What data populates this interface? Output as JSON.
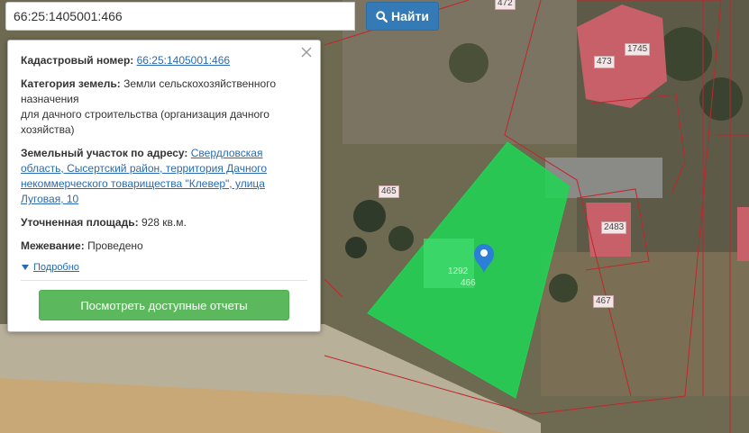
{
  "search": {
    "value": "66:25:1405001:466",
    "button_label": "Найти"
  },
  "info": {
    "cadastral_label": "Кадастровый номер:",
    "cadastral_value": "66:25:1405001:466",
    "category_label": "Категория земель:",
    "category_value": "Земли сельскохозяйственного назначения",
    "category_value_2": "для дачного строительства (организация дачного хозяйства)",
    "address_label": "Земельный участок по адресу:",
    "address_value": "Свердловская область, Сысертский район, территория Дачного некоммерческого товарищества \"Клевер\", улица Луговая, 10",
    "area_label": "Уточненная площадь:",
    "area_value": "928 кв.м.",
    "survey_label": "Межевание:",
    "survey_value": "Проведено",
    "more_label": "Подробно",
    "reports_button": "Посмотреть доступные отчеты"
  },
  "map": {
    "labels": [
      "472",
      "1745",
      "473",
      "465",
      "2483",
      "467",
      "1292",
      "466"
    ]
  },
  "colors": {
    "parcel_fill": "#21d354",
    "boundary": "#c0262c",
    "building": "#c8606a",
    "primary": "#337ab7",
    "success": "#5cb85c",
    "marker": "#2b7fd6"
  }
}
